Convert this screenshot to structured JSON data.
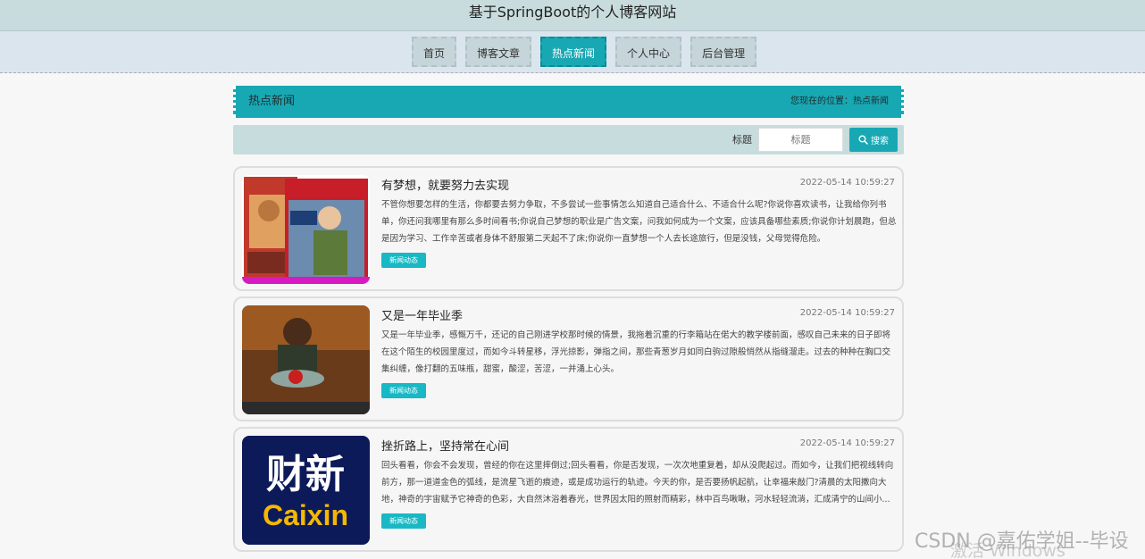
{
  "site": {
    "title": "基于SpringBoot的个人博客网站"
  },
  "nav": {
    "items": [
      {
        "label": "首页"
      },
      {
        "label": "博客文章"
      },
      {
        "label": "热点新闻"
      },
      {
        "label": "个人中心"
      },
      {
        "label": "后台管理"
      }
    ],
    "active": "热点新闻"
  },
  "section": {
    "title": "热点新闻",
    "breadcrumb": "您现在的位置：热点新闻"
  },
  "search": {
    "label": "标题",
    "placeholder": "标题",
    "button_label": "搜索"
  },
  "posts": [
    {
      "title": "有梦想，就要努力去实现",
      "time": "2022-05-14 10:59:27",
      "excerpt": "不管你想要怎样的生活，你都要去努力争取，不多尝试一些事情怎么知道自己适合什么、不适合什么呢?你说你喜欢读书，让我给你列书单，你还问我哪里有那么多时间看书;你说自己梦想的职业是广告文案，问我如何成为一个文案，应该具备哪些素质;你说你计划晨跑，但总是因为学习、工作辛苦或者身体不舒服第二天起不了床;你说你一直梦想一个人去长途旅行，但是没钱，父母觉得危险。",
      "tag": "新闻动态",
      "image": "环球人物 magazine covers"
    },
    {
      "title": "又是一年毕业季",
      "time": "2022-05-14 10:59:27",
      "excerpt": "又是一年毕业季，感慨万千，还记的自己刚进学校那时候的情景，我拖着沉重的行李箱站在偌大的教学楼前面，感叹自己未来的日子即将在这个陌生的校园里度过，而如今斗转星移，浮光掠影，弹指之间，那些青葱岁月如同白驹过隙般悄然从指缝溜走。过去的种种在胸口交集纠缠，像打翻的五味瓶，甜蜜，酸涩，苦涩，一并涌上心头。",
      "tag": "新闻动态",
      "image": "film still"
    },
    {
      "title": "挫折路上，坚持常在心间",
      "time": "2022-05-14 10:59:27",
      "excerpt": "回头看看，你会不会发现，曾经的你在这里摔倒过;回头看看，你是否发现，一次次地重复着，却从没爬起过。而如今，让我们把视线转向前方，那一道道金色的弧线，是流星飞逝的痕迹，或是成功运行的轨迹。今天的你，是否要扬帆起航，让幸福来敲门?清晨的太阳撒向大地，神奇的宇宙赋予它神奇的色彩，大自然沐浴着春光，世界因太阳的照射而精彩，林中百鸟啾啾，河水轻轻流淌，汇成清宁的山间小...",
      "tag": "新闻动态",
      "image": "财新 Caixin logo"
    }
  ],
  "overlay": {
    "watermark": "CSDN @嘉佑学姐--毕设",
    "activation": "激活 Windows"
  },
  "colors": {
    "accent": "#18a8b4",
    "topbar": "#c9dcdd",
    "navbar": "#dbe5ee"
  }
}
